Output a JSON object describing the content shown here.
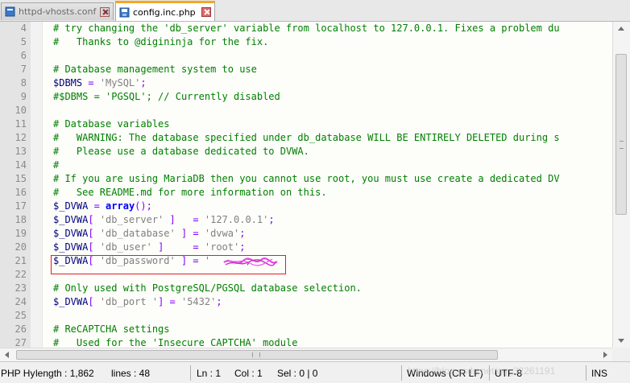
{
  "tabs": [
    {
      "label": "httpd-vhosts.conf",
      "active": false
    },
    {
      "label": "config.inc.php",
      "active": true
    }
  ],
  "colors": {
    "comment": "#008000",
    "variable": "#000080",
    "operator": "#8000ff",
    "string": "#808080",
    "keyword": "#0000ff",
    "highlight_box": "#e02020",
    "active_tab_accent": "#f5a623"
  },
  "lines": [
    {
      "num": "4",
      "tokens": [
        {
          "t": "# try changing the 'db_server' variable from localhost to 127.0.0.1. Fixes a problem du",
          "c": "com"
        }
      ]
    },
    {
      "num": "5",
      "tokens": [
        {
          "t": "#   Thanks to @digininja for the fix.",
          "c": "com"
        }
      ]
    },
    {
      "num": "6",
      "tokens": []
    },
    {
      "num": "7",
      "tokens": [
        {
          "t": "# Database management system to use",
          "c": "com"
        }
      ]
    },
    {
      "num": "8",
      "tokens": [
        {
          "t": "$DBMS",
          "c": "var"
        },
        {
          "t": " = ",
          "c": "op"
        },
        {
          "t": "'MySQL'",
          "c": "str"
        },
        {
          "t": ";",
          "c": "op"
        }
      ]
    },
    {
      "num": "9",
      "tokens": [
        {
          "t": "#$DBMS = 'PGSQL'; // Currently disabled",
          "c": "com"
        }
      ]
    },
    {
      "num": "10",
      "tokens": []
    },
    {
      "num": "11",
      "tokens": [
        {
          "t": "# Database variables",
          "c": "com"
        }
      ]
    },
    {
      "num": "12",
      "tokens": [
        {
          "t": "#   WARNING: The database specified under db_database WILL BE ENTIRELY DELETED during s",
          "c": "com"
        }
      ]
    },
    {
      "num": "13",
      "tokens": [
        {
          "t": "#   Please use a database dedicated to DVWA.",
          "c": "com"
        }
      ]
    },
    {
      "num": "14",
      "tokens": [
        {
          "t": "#",
          "c": "com"
        }
      ]
    },
    {
      "num": "15",
      "tokens": [
        {
          "t": "# If you are using MariaDB then you cannot use root, you must use create a dedicated DV",
          "c": "com"
        }
      ]
    },
    {
      "num": "16",
      "tokens": [
        {
          "t": "#   See README.md for more information on this.",
          "c": "com"
        }
      ]
    },
    {
      "num": "17",
      "tokens": [
        {
          "t": "$_DVWA",
          "c": "var"
        },
        {
          "t": " = ",
          "c": "op"
        },
        {
          "t": "array",
          "c": "kw"
        },
        {
          "t": "();",
          "c": "op"
        }
      ]
    },
    {
      "num": "18",
      "tokens": [
        {
          "t": "$_DVWA",
          "c": "var"
        },
        {
          "t": "[ ",
          "c": "op"
        },
        {
          "t": "'db_server'",
          "c": "str"
        },
        {
          "t": " ]   = ",
          "c": "op"
        },
        {
          "t": "'127.0.0.1'",
          "c": "str"
        },
        {
          "t": ";",
          "c": "op"
        }
      ]
    },
    {
      "num": "19",
      "tokens": [
        {
          "t": "$_DVWA",
          "c": "var"
        },
        {
          "t": "[ ",
          "c": "op"
        },
        {
          "t": "'db_database'",
          "c": "str"
        },
        {
          "t": " ] = ",
          "c": "op"
        },
        {
          "t": "'dvwa'",
          "c": "str"
        },
        {
          "t": ";",
          "c": "op"
        }
      ]
    },
    {
      "num": "20",
      "tokens": [
        {
          "t": "$_DVWA",
          "c": "var"
        },
        {
          "t": "[ ",
          "c": "op"
        },
        {
          "t": "'db_user'",
          "c": "str"
        },
        {
          "t": " ]     = ",
          "c": "op"
        },
        {
          "t": "'root'",
          "c": "str"
        },
        {
          "t": ";",
          "c": "op"
        }
      ]
    },
    {
      "num": "21",
      "tokens": [
        {
          "t": "$_DVWA",
          "c": "var"
        },
        {
          "t": "[ ",
          "c": "op"
        },
        {
          "t": "'db_password'",
          "c": "str"
        },
        {
          "t": " ] = ",
          "c": "op"
        },
        {
          "t": "'",
          "c": "str"
        },
        {
          "t": "      ",
          "c": "str"
        },
        {
          "t": ";",
          "c": "op"
        }
      ]
    },
    {
      "num": "22",
      "tokens": []
    },
    {
      "num": "23",
      "tokens": [
        {
          "t": "# Only used with PostgreSQL/PGSQL database selection.",
          "c": "com"
        }
      ]
    },
    {
      "num": "24",
      "tokens": [
        {
          "t": "$_DVWA",
          "c": "var"
        },
        {
          "t": "[ ",
          "c": "op"
        },
        {
          "t": "'db_port '",
          "c": "str"
        },
        {
          "t": "] = ",
          "c": "op"
        },
        {
          "t": "'5432'",
          "c": "str"
        },
        {
          "t": ";",
          "c": "op"
        }
      ]
    },
    {
      "num": "25",
      "tokens": []
    },
    {
      "num": "26",
      "tokens": [
        {
          "t": "# ReCAPTCHA settings",
          "c": "com"
        }
      ]
    },
    {
      "num": "27",
      "tokens": [
        {
          "t": "#   Used for the 'Insecure CAPTCHA' module",
          "c": "com"
        }
      ]
    }
  ],
  "status": {
    "language": "PHP Hy",
    "length": "length : 1,862",
    "lines": "lines : 48",
    "ln": "Ln : 1",
    "col": "Col : 1",
    "sel": "Sel : 0 | 0",
    "eol": "Windows (CR LF)",
    "encoding": "UTF-8",
    "mode": "INS"
  },
  "watermark": "https://blog.csdn.net/qq_32261191"
}
